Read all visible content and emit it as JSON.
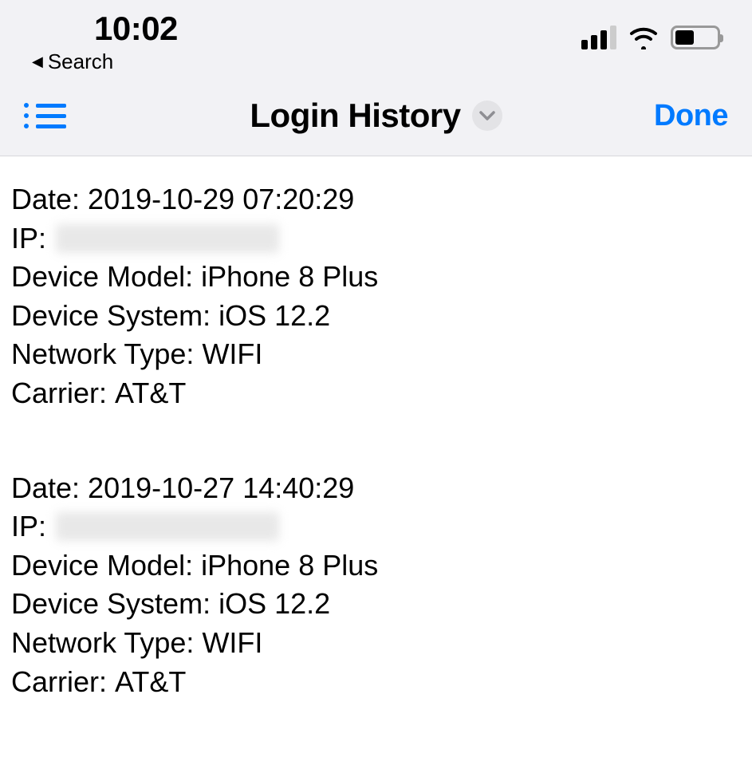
{
  "statusbar": {
    "time": "10:02",
    "back_label": "Search"
  },
  "navbar": {
    "title": "Login History",
    "done_label": "Done"
  },
  "labels": {
    "date": "Date: ",
    "ip": "IP: ",
    "device_model": "Device Model: ",
    "device_system": "Device System: ",
    "network_type": "Network Type: ",
    "carrier": "Carrier: "
  },
  "entries": [
    {
      "date": "2019-10-29 07:20:29",
      "ip": "",
      "device_model": "iPhone 8 Plus",
      "device_system": "iOS 12.2",
      "network_type": "WIFI",
      "carrier": "AT&T"
    },
    {
      "date": "2019-10-27 14:40:29",
      "ip": "",
      "device_model": "iPhone 8 Plus",
      "device_system": "iOS 12.2",
      "network_type": "WIFI",
      "carrier": "AT&T"
    }
  ]
}
